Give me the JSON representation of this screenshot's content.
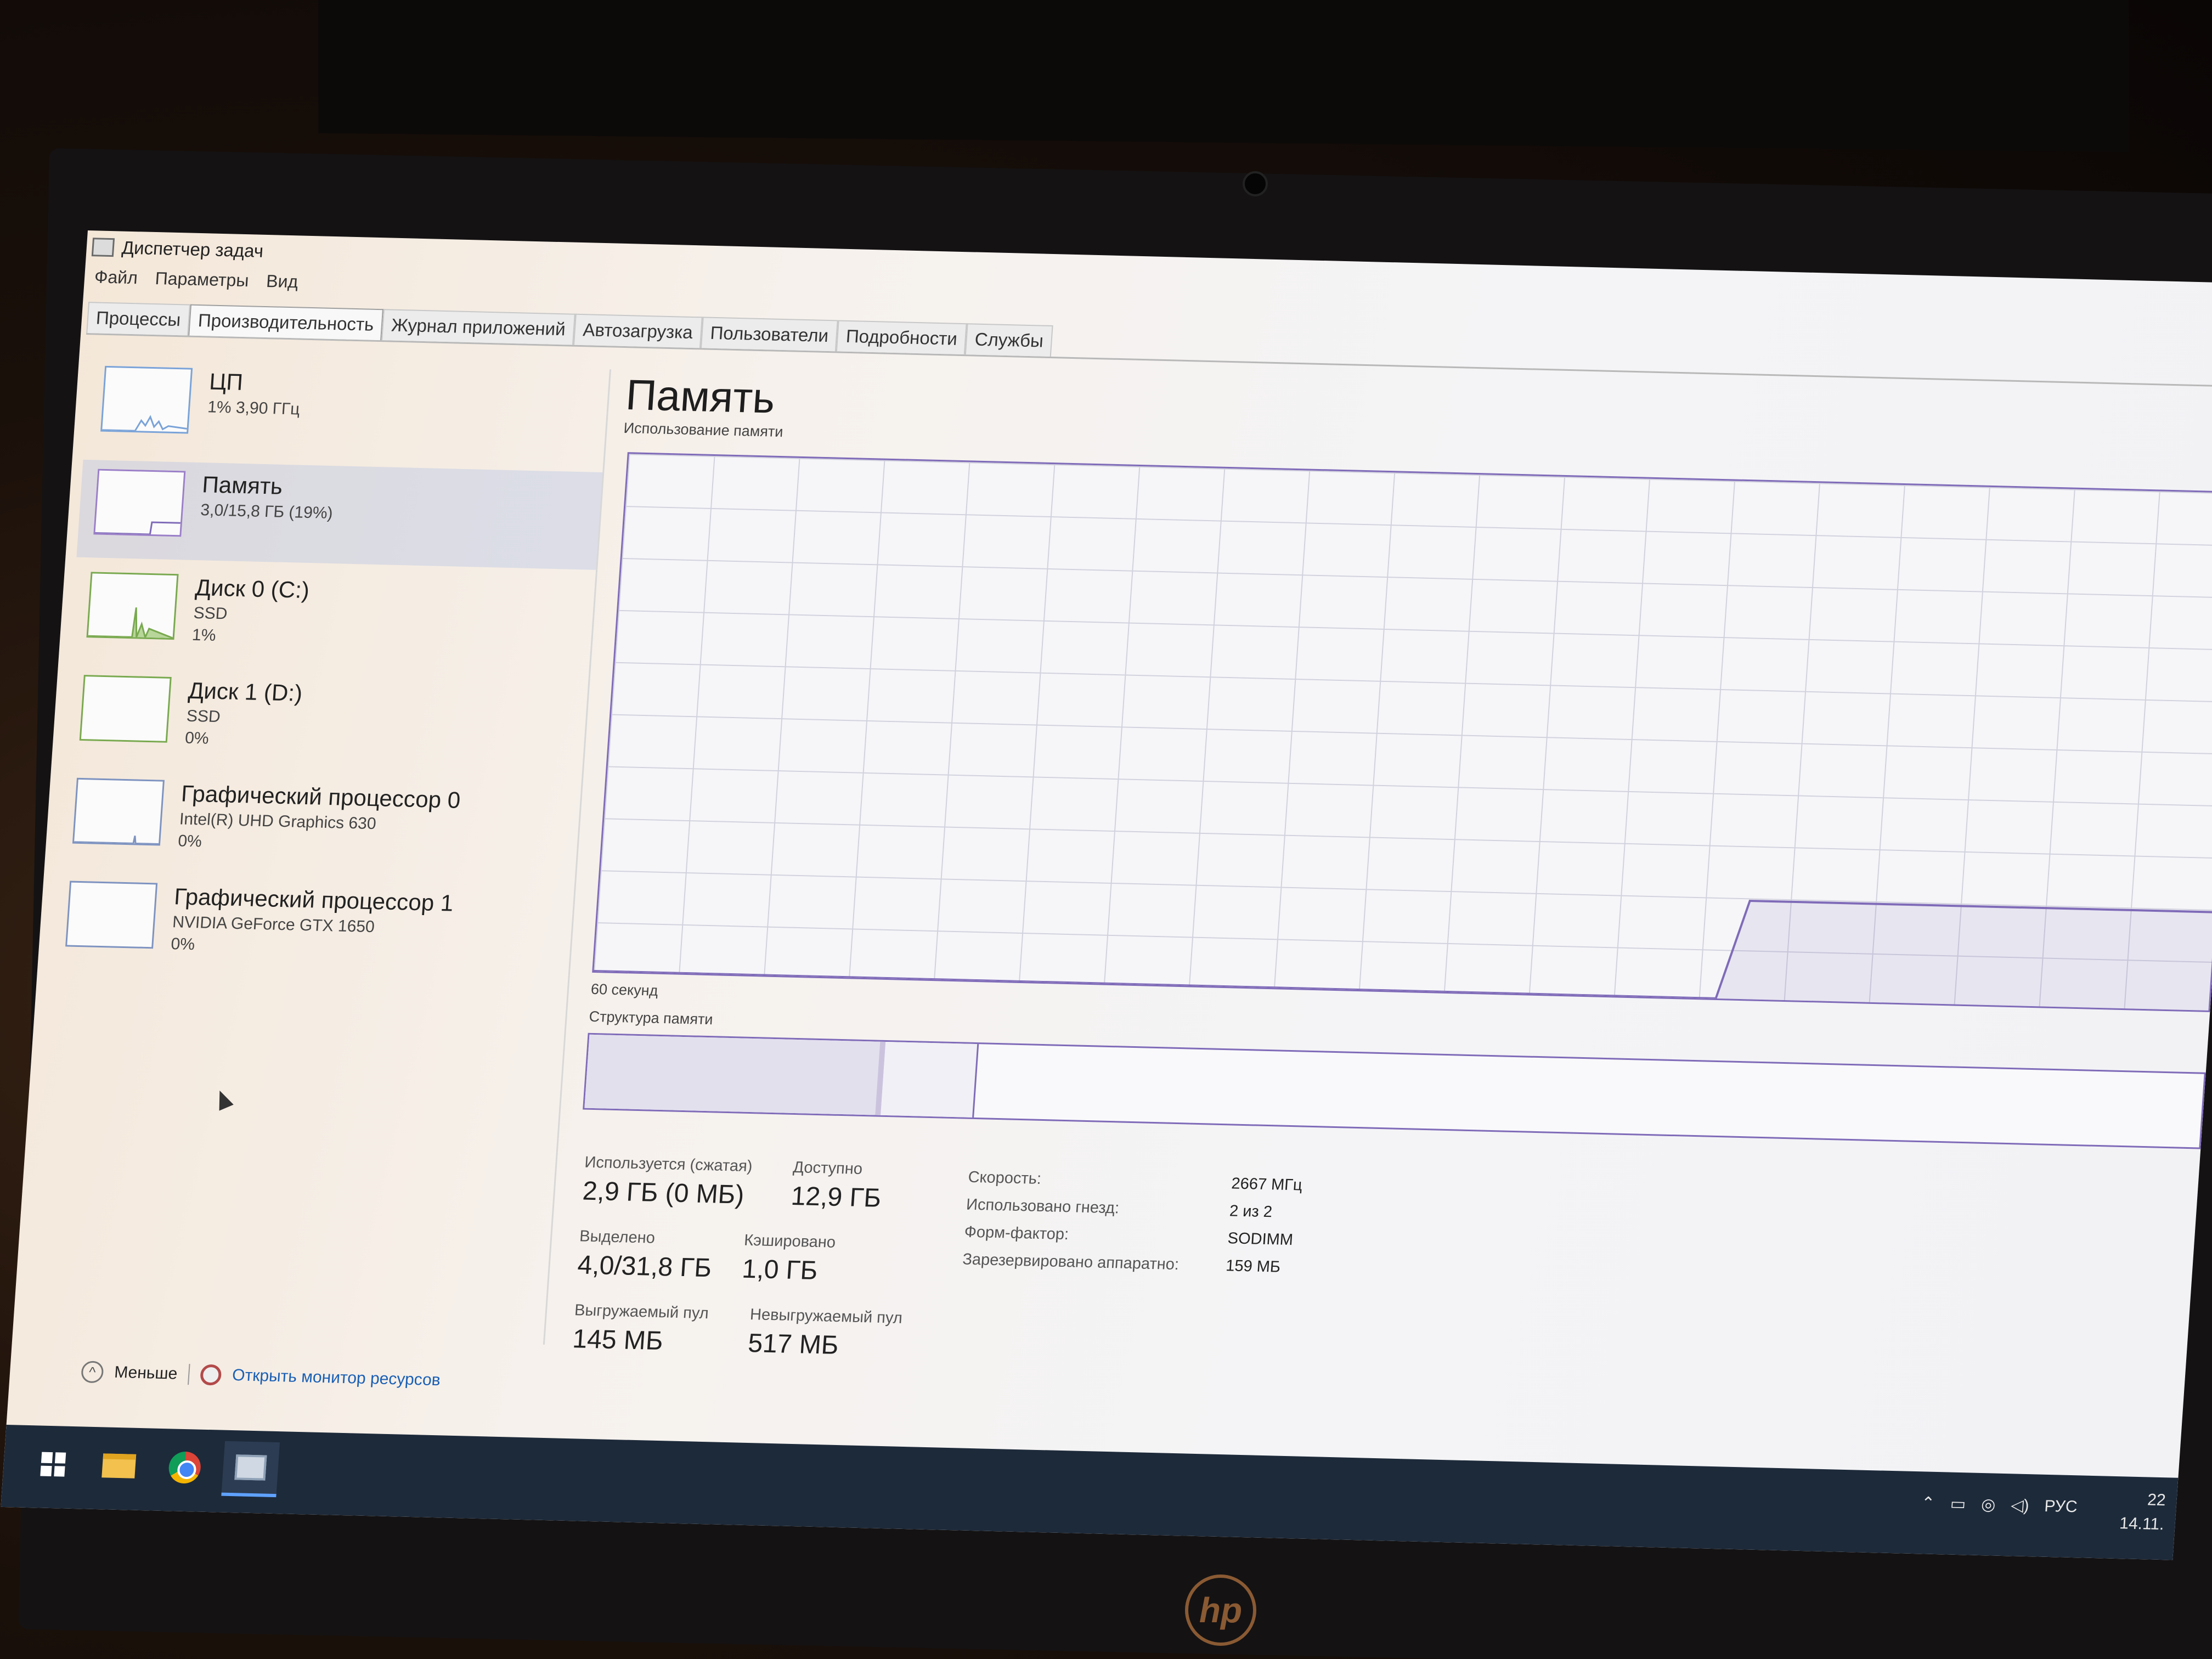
{
  "window": {
    "title": "Диспетчер задач"
  },
  "menu": [
    "Файл",
    "Параметры",
    "Вид"
  ],
  "tabs": [
    "Процессы",
    "Производительность",
    "Журнал приложений",
    "Автозагрузка",
    "Пользователи",
    "Подробности",
    "Службы"
  ],
  "active_tab": "Производительность",
  "sidebar": {
    "items": [
      {
        "name": "ЦП",
        "line1": "1% 3,90 ГГц",
        "line2": ""
      },
      {
        "name": "Память",
        "line1": "3,0/15,8 ГБ (19%)",
        "line2": ""
      },
      {
        "name": "Диск 0 (C:)",
        "line1": "SSD",
        "line2": "1%"
      },
      {
        "name": "Диск 1 (D:)",
        "line1": "SSD",
        "line2": "0%"
      },
      {
        "name": "Графический процессор 0",
        "line1": "Intel(R) UHD Graphics 630",
        "line2": "0%"
      },
      {
        "name": "Графический процессор 1",
        "line1": "NVIDIA GeForce GTX 1650",
        "line2": "0%"
      }
    ],
    "selected": "Память"
  },
  "main": {
    "title": "Память",
    "usage_label": "Использование памяти",
    "time_label": "60 секунд",
    "structure_label": "Структура памяти",
    "usage_history_fraction": [
      0,
      0,
      0,
      0,
      0,
      0,
      0,
      0,
      0,
      0,
      0,
      0,
      0,
      0,
      0,
      0,
      0,
      0,
      0,
      0,
      0,
      0,
      0,
      0,
      0,
      0,
      0,
      0,
      0,
      0,
      0,
      0,
      0,
      0,
      0,
      0,
      0,
      0,
      0,
      0,
      0,
      0,
      0.19,
      0.19,
      0.19,
      0.19,
      0.19,
      0.19,
      0.19,
      0.19,
      0.19,
      0.19,
      0.19,
      0.19,
      0.19,
      0.19,
      0.19,
      0.19,
      0.19,
      0.19
    ]
  },
  "stats": {
    "in_use": {
      "label": "Используется (сжатая)",
      "value": "2,9 ГБ (0 МБ)"
    },
    "available": {
      "label": "Доступно",
      "value": "12,9 ГБ"
    },
    "committed": {
      "label": "Выделено",
      "value": "4,0/31,8 ГБ"
    },
    "cached": {
      "label": "Кэшировано",
      "value": "1,0 ГБ"
    },
    "paged_pool": {
      "label": "Выгружаемый пул",
      "value": "145 МБ"
    },
    "nonpaged_pool": {
      "label": "Невыгружаемый пул",
      "value": "517 МБ"
    }
  },
  "details": [
    {
      "key": "Скорость:",
      "value": "2667 МГц"
    },
    {
      "key": "Использовано гнезд:",
      "value": "2 из 2"
    },
    {
      "key": "Форм-фактор:",
      "value": "SODIMM"
    },
    {
      "key": "Зарезервировано аппаратно:",
      "value": "159 МБ"
    }
  ],
  "footer": {
    "fewer": "Меньше",
    "resmon": "Открыть монитор ресурсов"
  },
  "taskbar": {
    "lang": "РУС",
    "time": "22",
    "date": "14.11."
  },
  "icons": [
    "task-manager-icon",
    "windows-start-icon",
    "file-explorer-icon",
    "chrome-icon",
    "chevron-up-icon",
    "battery-icon",
    "network-icon",
    "volume-icon",
    "resource-monitor-icon",
    "cursor-icon"
  ],
  "colors": {
    "memory_accent": "#7f6bb8",
    "cpu_accent": "#7aa3d8",
    "disk_accent": "#79a94f",
    "taskbar": "#1d2a3a"
  }
}
